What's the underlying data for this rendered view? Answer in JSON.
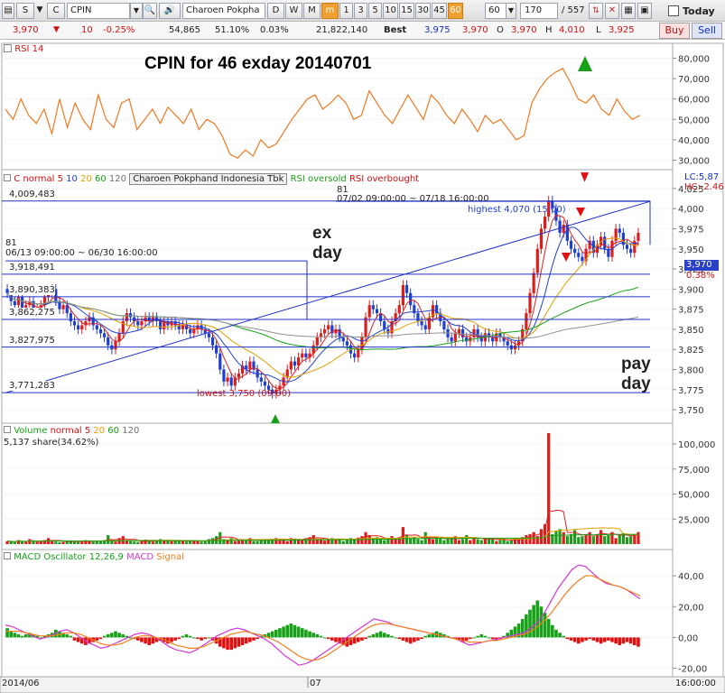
{
  "toolbar": {
    "s_label": "S",
    "c_label": "C",
    "symbol": "CPIN",
    "company_name": "Charoen Pokpha",
    "periods": [
      "D",
      "W",
      "M",
      "m",
      "1",
      "3",
      "5",
      "10",
      "15",
      "30",
      "45",
      "60"
    ],
    "selected_period": "60",
    "period_select": "60",
    "count": "170",
    "total": "/ 557",
    "today_label": "Today"
  },
  "quote": {
    "price": "3,970",
    "arrow": "▼",
    "change": "10",
    "change_pct": "-0.25%",
    "volume": "54,865",
    "vol_pct": "51.10%",
    "turn": "0.03%",
    "value": "21,822,140",
    "best_label": "Best",
    "best_bid": "3,975",
    "best_ask": "3,970",
    "o_label": "O",
    "o": "3,970",
    "h_label": "H",
    "h": "4,010",
    "l_label": "L",
    "l": "3,925",
    "buy_label": "Buy",
    "sell_label": "Sell"
  },
  "rsi_panel": {
    "label": "RSI 14",
    "title": "CPIN for 46 exday 20140701",
    "ticks": [
      "80,000",
      "70,000",
      "60,000",
      "50,000",
      "40,000",
      "30,000"
    ]
  },
  "price_panel": {
    "legend": {
      "c": "C",
      "normal": "normal",
      "ma5": "5",
      "ma10": "10",
      "ma20": "20",
      "ma60": "60",
      "ma120": "120",
      "name": "Charoen Pokphand Indonesia Tbk",
      "oversold": "RSI oversold",
      "overbought": "RSI overbought"
    },
    "lc": "LC:5,87",
    "hc": "HC:-2.46",
    "last_price": "3,970",
    "last_pct": "0.38%",
    "ticks": [
      "4,025",
      "4,000",
      "3,975",
      "3,950",
      "3,925",
      "3,900",
      "3,875",
      "3,850",
      "3,825",
      "3,800",
      "3,775",
      "3,750"
    ],
    "levels": [
      "4,009,483",
      "3,918,491",
      "3,890,383",
      "3,862,275",
      "3,827,975",
      "3,771,283"
    ],
    "range1_count": "81",
    "range1": "06/13 09:00:00 ~ 06/30 16:00:00",
    "range2_count": "81",
    "range2": "07/02 09:00:00 ~ 07/18 16:00:00",
    "highest": "highest 4,070 (15:00)",
    "lowest": "lowest 3,750 (09:00)",
    "ex_day_1": "ex",
    "ex_day_2": "day",
    "pay_day_1": "pay",
    "pay_day_2": "day"
  },
  "volume_panel": {
    "label": "Volume",
    "normal": "normal",
    "ma5": "5",
    "ma20": "20",
    "ma60": "60",
    "ma120": "120",
    "info": "5,137 share(34.62%)",
    "ticks": [
      "100,000",
      "75,000",
      "50,000",
      "25,000"
    ]
  },
  "macd_panel": {
    "label": "MACD Oscillator 12,26,9",
    "macd": "MACD",
    "signal": "Signal",
    "ticks": [
      "40,00",
      "20,00",
      "0,00",
      "-20,00"
    ]
  },
  "xaxis": {
    "start": "2014/06",
    "mid": "07",
    "time": "16:00:00"
  },
  "colors": {
    "up": "#dd1c1c",
    "down": "#1f3fd0",
    "rsi": "#f07820",
    "volume_up": "#dd1c1c",
    "volume_down": "#1f9a1f",
    "macd": "#d238d2",
    "signal": "#f08020"
  },
  "chart_data": {
    "type": "candlestick",
    "title": "CPIN for 46 exday 20140701",
    "symbol": "CPIN",
    "interval": "60 min",
    "ylim_price": [
      3740,
      4035
    ],
    "ylim_volume": [
      0,
      110000
    ],
    "ylim_rsi": [
      28000,
      82000
    ],
    "ylim_macd": [
      -22,
      50
    ],
    "close": [
      3895,
      3885,
      3880,
      3890,
      3875,
      3880,
      3885,
      3870,
      3875,
      3880,
      3890,
      3895,
      3900,
      3885,
      3875,
      3880,
      3870,
      3860,
      3855,
      3850,
      3855,
      3860,
      3865,
      3855,
      3850,
      3845,
      3840,
      3830,
      3825,
      3835,
      3845,
      3860,
      3870,
      3865,
      3860,
      3855,
      3860,
      3865,
      3860,
      3865,
      3860,
      3850,
      3860,
      3855,
      3860,
      3855,
      3850,
      3855,
      3850,
      3845,
      3850,
      3855,
      3850,
      3845,
      3840,
      3830,
      3820,
      3800,
      3785,
      3790,
      3780,
      3790,
      3795,
      3805,
      3800,
      3810,
      3800,
      3790,
      3785,
      3780,
      3775,
      3770,
      3775,
      3780,
      3790,
      3800,
      3810,
      3805,
      3815,
      3820,
      3815,
      3820,
      3830,
      3840,
      3845,
      3850,
      3855,
      3845,
      3850,
      3840,
      3835,
      3830,
      3820,
      3815,
      3825,
      3840,
      3865,
      3880,
      3875,
      3870,
      3860,
      3850,
      3845,
      3860,
      3870,
      3880,
      3905,
      3895,
      3880,
      3870,
      3860,
      3855,
      3850,
      3865,
      3880,
      3870,
      3860,
      3850,
      3840,
      3835,
      3845,
      3850,
      3840,
      3835,
      3840,
      3850,
      3840,
      3835,
      3845,
      3840,
      3835,
      3845,
      3840,
      3835,
      3830,
      3825,
      3830,
      3835,
      3850,
      3870,
      3895,
      3920,
      3950,
      3975,
      3990,
      4010,
      4000,
      3985,
      3970,
      3980,
      3960,
      3950,
      3945,
      3940,
      3935,
      3950,
      3960,
      3945,
      3955,
      3965,
      3950,
      3940,
      3960,
      3975,
      3970,
      3955,
      3950,
      3945,
      3960,
      3970
    ],
    "volume": [
      3000,
      2500,
      2000,
      4000,
      2600,
      2200,
      5000,
      3000,
      2500,
      2800,
      4000,
      6000,
      3500,
      2500,
      2000,
      2400,
      3000,
      3500,
      2200,
      2600,
      3000,
      4000,
      3000,
      2500,
      2800,
      3500,
      4000,
      9000,
      3000,
      2500,
      6000,
      8000,
      4000,
      3000,
      2500,
      2200,
      3000,
      4500,
      3000,
      2500,
      3000,
      5000,
      3500,
      3000,
      2800,
      3200,
      4000,
      3000,
      2500,
      3500,
      4000,
      3000,
      2500,
      2800,
      5000,
      6000,
      8000,
      12000,
      5000,
      4000,
      6000,
      3000,
      3500,
      5000,
      4000,
      6000,
      3000,
      3000,
      3500,
      4000,
      5000,
      5000,
      6000,
      4000,
      5000,
      3000,
      6000,
      5500,
      4000,
      5000,
      6000,
      7000,
      9000,
      5000,
      4000,
      3500,
      4500,
      6000,
      4000,
      5500,
      3000,
      4000,
      6000,
      5000,
      6500,
      8000,
      12000,
      9000,
      6000,
      7000,
      5000,
      4000,
      6000,
      8000,
      5000,
      7000,
      17000,
      9000,
      6000,
      7000,
      5000,
      4000,
      12000,
      6000,
      5000,
      7000,
      6000,
      4000,
      5000,
      6000,
      8000,
      4000,
      5000,
      9000,
      4000,
      7000,
      5000,
      4000,
      5000,
      6000,
      5000,
      3000,
      4000,
      5000,
      3000,
      4000,
      6000,
      5000,
      7000,
      9000,
      10000,
      12000,
      8000,
      15000,
      20000,
      111000,
      10000,
      13000,
      15000,
      12000,
      8000,
      10000,
      14000,
      7000,
      8000,
      9000,
      12000,
      8000,
      10000,
      14000,
      8000,
      9000,
      12000,
      6000,
      9000,
      11000,
      7000,
      8000,
      10000,
      12000
    ],
    "rsi_xy": [
      [
        0,
        55000
      ],
      [
        2,
        50000
      ],
      [
        4,
        60000
      ],
      [
        6,
        52000
      ],
      [
        8,
        48000
      ],
      [
        10,
        55000
      ],
      [
        12,
        43000
      ],
      [
        14,
        60000
      ],
      [
        16,
        46000
      ],
      [
        18,
        58000
      ],
      [
        20,
        50000
      ],
      [
        22,
        45000
      ],
      [
        24,
        62000
      ],
      [
        26,
        50000
      ],
      [
        28,
        46000
      ],
      [
        30,
        58000
      ],
      [
        32,
        60000
      ],
      [
        34,
        45000
      ],
      [
        36,
        50000
      ],
      [
        38,
        55000
      ],
      [
        40,
        48000
      ],
      [
        42,
        56000
      ],
      [
        44,
        52000
      ],
      [
        46,
        48000
      ],
      [
        48,
        55000
      ],
      [
        50,
        45000
      ],
      [
        52,
        50000
      ],
      [
        54,
        48000
      ],
      [
        56,
        42000
      ],
      [
        58,
        33000
      ],
      [
        60,
        31000
      ],
      [
        62,
        35000
      ],
      [
        64,
        32000
      ],
      [
        66,
        40000
      ],
      [
        68,
        36000
      ],
      [
        70,
        38000
      ],
      [
        72,
        44000
      ],
      [
        74,
        50000
      ],
      [
        76,
        55000
      ],
      [
        78,
        60000
      ],
      [
        80,
        62000
      ],
      [
        82,
        55000
      ],
      [
        84,
        58000
      ],
      [
        86,
        62000
      ],
      [
        88,
        58000
      ],
      [
        90,
        50000
      ],
      [
        92,
        52000
      ],
      [
        94,
        64000
      ],
      [
        96,
        58000
      ],
      [
        98,
        52000
      ],
      [
        100,
        48000
      ],
      [
        102,
        55000
      ],
      [
        104,
        62000
      ],
      [
        106,
        56000
      ],
      [
        108,
        50000
      ],
      [
        110,
        62000
      ],
      [
        112,
        58000
      ],
      [
        114,
        52000
      ],
      [
        116,
        48000
      ],
      [
        118,
        55000
      ],
      [
        120,
        50000
      ],
      [
        122,
        44000
      ],
      [
        124,
        52000
      ],
      [
        126,
        48000
      ],
      [
        128,
        50000
      ],
      [
        130,
        45000
      ],
      [
        132,
        40000
      ],
      [
        134,
        42000
      ],
      [
        136,
        58000
      ],
      [
        138,
        65000
      ],
      [
        140,
        70000
      ],
      [
        142,
        73000
      ],
      [
        144,
        75000
      ],
      [
        146,
        68000
      ],
      [
        148,
        60000
      ],
      [
        150,
        58000
      ],
      [
        152,
        62000
      ],
      [
        154,
        55000
      ],
      [
        156,
        52000
      ],
      [
        158,
        60000
      ],
      [
        160,
        54000
      ],
      [
        162,
        50000
      ],
      [
        164,
        52000
      ]
    ],
    "macd_hist": [
      6,
      4,
      3,
      2,
      1,
      2,
      3,
      2,
      1,
      0,
      1,
      2,
      3,
      5,
      4,
      3,
      2,
      1,
      -2,
      -3,
      -4,
      -5,
      -4,
      -3,
      -2,
      -1,
      1,
      2,
      3,
      4,
      3,
      2,
      1,
      0,
      -1,
      -2,
      -3,
      -4,
      -5,
      -4,
      -3,
      -2,
      -3,
      -4,
      -3,
      -2,
      -1,
      1,
      2,
      1,
      0,
      -1,
      -2,
      -1,
      0,
      -2,
      -4,
      -6,
      -7,
      -8,
      -8,
      -7,
      -6,
      -5,
      -4,
      -3,
      -2,
      -1,
      1,
      2,
      3,
      4,
      5,
      6,
      7,
      8,
      9,
      8,
      7,
      6,
      5,
      4,
      3,
      2,
      1,
      0,
      -1,
      -2,
      -3,
      -4,
      -5,
      -6,
      -5,
      -4,
      -3,
      -2,
      -1,
      1,
      2,
      3,
      4,
      3,
      2,
      1,
      0,
      -1,
      -2,
      -3,
      -4,
      -3,
      -2,
      -1,
      1,
      2,
      3,
      4,
      3,
      2,
      1,
      0,
      -1,
      -2,
      -3,
      -2,
      -1,
      0,
      1,
      2,
      1,
      0,
      -1,
      -2,
      -1,
      1,
      3,
      5,
      7,
      9,
      12,
      15,
      18,
      21,
      24,
      20,
      16,
      12,
      8,
      5,
      3,
      1,
      -1,
      -2,
      -3,
      -4,
      -3,
      -2,
      -1,
      -2,
      -3,
      -4,
      -3,
      -2,
      -3,
      -4,
      -5,
      -4,
      -3,
      -4,
      -5,
      -6
    ],
    "macd_line": [
      8,
      7,
      5,
      3,
      1,
      -1,
      0,
      2,
      4,
      5,
      3,
      0,
      -3,
      -5,
      -7,
      -6,
      -4,
      -2,
      0,
      2,
      3,
      2,
      0,
      -3,
      -6,
      -8,
      -9,
      -10,
      -8,
      -5,
      -2,
      1,
      3,
      5,
      6,
      5,
      3,
      1,
      -1,
      -4,
      -8,
      -12,
      -15,
      -18,
      -17,
      -15,
      -12,
      -9,
      -6,
      -3,
      0,
      3,
      6,
      9,
      12,
      11,
      10,
      8,
      7,
      6,
      5,
      4,
      3,
      2,
      1,
      0,
      -1,
      -3,
      -5,
      -4,
      -3,
      -2,
      -1,
      0,
      1,
      2,
      3,
      6,
      10,
      16,
      24,
      32,
      38,
      44,
      47,
      46,
      42,
      38,
      35,
      34,
      33,
      31,
      28,
      25
    ],
    "signal_line": [
      4,
      4,
      4,
      3,
      2,
      1,
      1,
      1,
      2,
      3,
      3,
      2,
      0,
      -2,
      -4,
      -5,
      -5,
      -4,
      -2,
      0,
      1,
      1,
      0,
      -1,
      -3,
      -5,
      -6,
      -7,
      -7,
      -6,
      -4,
      -2,
      0,
      2,
      3,
      4,
      3,
      2,
      1,
      -1,
      -3,
      -6,
      -9,
      -12,
      -14,
      -15,
      -14,
      -12,
      -9,
      -6,
      -3,
      0,
      3,
      6,
      8,
      9,
      9,
      8,
      7,
      6,
      5,
      4,
      3,
      2,
      1,
      0,
      -1,
      -2,
      -3,
      -3,
      -3,
      -2,
      -2,
      -1,
      0,
      1,
      2,
      4,
      7,
      11,
      16,
      22,
      28,
      33,
      37,
      40,
      40,
      38,
      36,
      34,
      33,
      31,
      29,
      27
    ]
  }
}
